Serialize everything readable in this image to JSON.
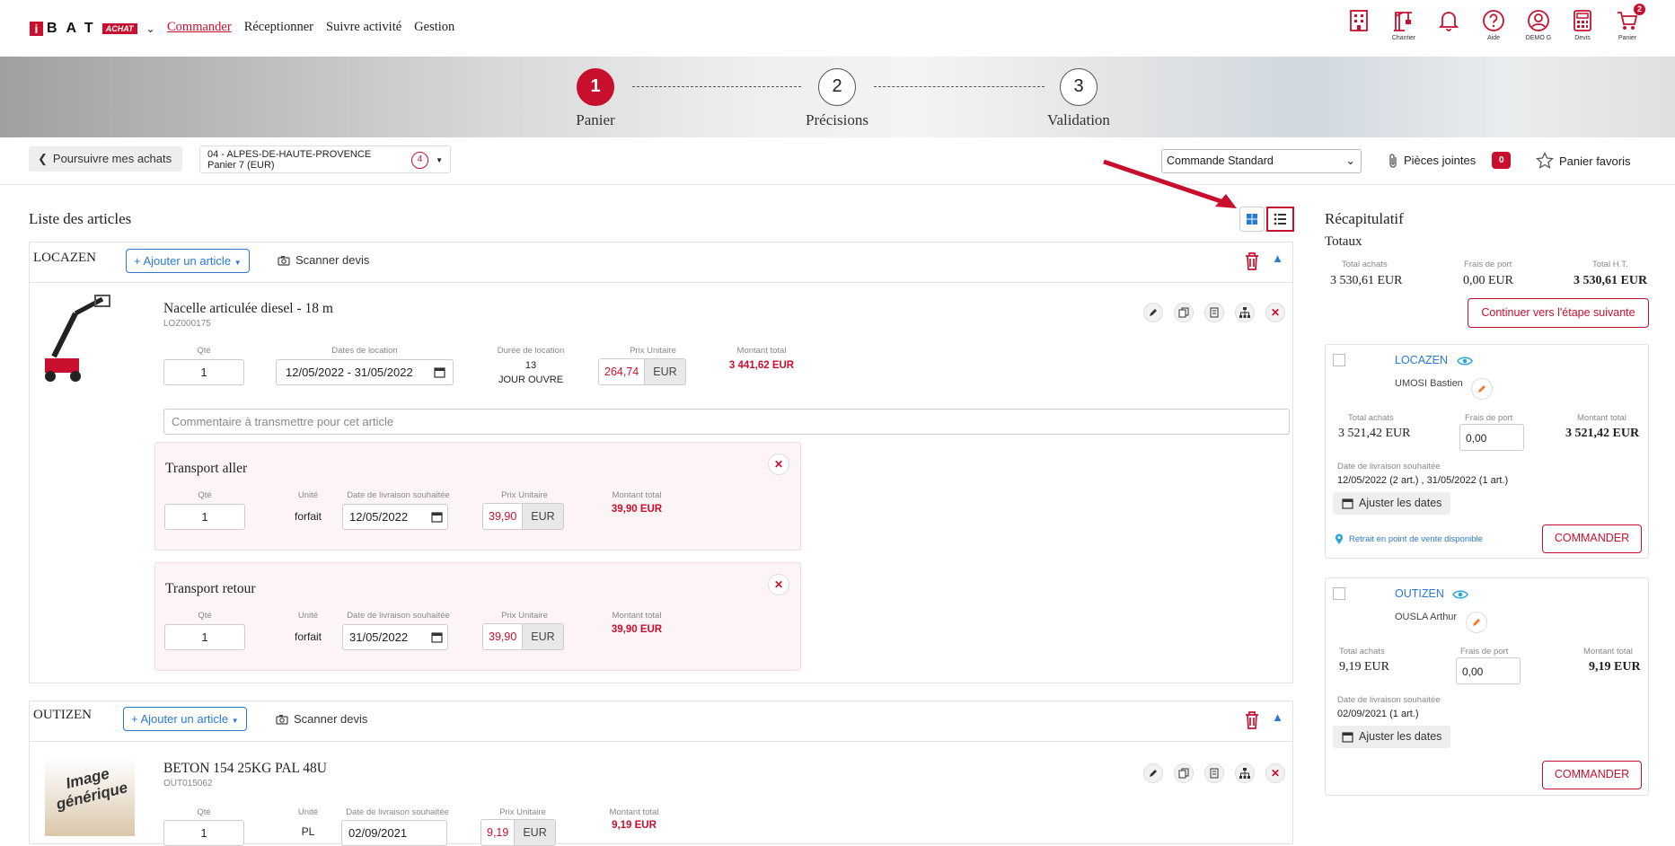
{
  "brand": {
    "name": "BAT",
    "badge": "ACHAT"
  },
  "nav": [
    "Commander",
    "Réceptionner",
    "Suivre activité",
    "Gestion"
  ],
  "top_icons": [
    {
      "icon": "building-icon",
      "label": ""
    },
    {
      "icon": "crane-icon",
      "label": "Chantier"
    },
    {
      "icon": "bell-icon",
      "label": ""
    },
    {
      "icon": "help-icon",
      "label": "Aide"
    },
    {
      "icon": "user-icon",
      "label": "DEMO G"
    },
    {
      "icon": "calculator-icon",
      "label": "Devis"
    },
    {
      "icon": "cart-icon",
      "label": "Panier",
      "badge": "2"
    }
  ],
  "steps": [
    {
      "num": "1",
      "label": "Panier"
    },
    {
      "num": "2",
      "label": "Précisions"
    },
    {
      "num": "3",
      "label": "Validation"
    }
  ],
  "toolbar": {
    "continue": "Poursuivre mes achats",
    "cart_line1": "04 - ALPES-DE-HAUTE-PROVENCE",
    "cart_line2": "Panier 7 (EUR)",
    "cart_count": "4",
    "order_type": "Commande Standard",
    "attachments": "Pièces jointes",
    "attachments_count": "0",
    "favorites": "Panier favoris"
  },
  "list_title": "Liste des articles",
  "suppliers": [
    {
      "name": "LOCAZEN",
      "add": "Ajouter un article",
      "scan": "Scanner devis",
      "article": {
        "title": "Nacelle articulée diesel - 18 m",
        "ref": "LOZ000175",
        "qty_label": "Qté",
        "qty": "1",
        "dates_label": "Dates de location",
        "dates": "12/05/2022 - 31/05/2022",
        "duration_label": "Durée de location",
        "duration": "13",
        "duration_unit": "JOUR OUVRE",
        "unit_price_label": "Prix Unitaire",
        "unit_price": "264,74",
        "currency": "EUR",
        "total_label": "Montant total",
        "total": "3 441,62 EUR",
        "comment_placeholder": "Commentaire à transmettre pour cet article"
      },
      "transports": [
        {
          "title": "Transport aller",
          "qty_label": "Qté",
          "qty": "1",
          "unit_label": "Unité",
          "unit": "forfait",
          "date_label": "Date de livraison souhaitée",
          "date": "12/05/2022",
          "price_label": "Prix Unitaire",
          "price": "39,90",
          "currency": "EUR",
          "total_label": "Montant total",
          "total": "39,90 EUR"
        },
        {
          "title": "Transport retour",
          "qty_label": "Qté",
          "qty": "1",
          "unit_label": "Unité",
          "unit": "forfait",
          "date_label": "Date de livraison souhaitée",
          "date": "31/05/2022",
          "price_label": "Prix Unitaire",
          "price": "39,90",
          "currency": "EUR",
          "total_label": "Montant total",
          "total": "39,90 EUR"
        }
      ]
    },
    {
      "name": "OUTIZEN",
      "add": "Ajouter un article",
      "scan": "Scanner devis",
      "article": {
        "title": "BETON 154 25KG PAL 48U",
        "ref": "OUT015062",
        "image_text": "Image générique",
        "qty_label": "Qté",
        "qty": "1",
        "unit_label": "Unité",
        "unit": "PL",
        "date_label": "Date de livraison souhaitée",
        "date": "02/09/2021",
        "price_label": "Prix Unitaire",
        "price": "9,19",
        "currency": "EUR",
        "total_label": "Montant total",
        "total": "9,19 EUR"
      }
    }
  ],
  "recap": {
    "title": "Récapitulatif",
    "totals_title": "Totaux",
    "labels": [
      "Total achats",
      "Frais de port",
      "Total H.T."
    ],
    "values": [
      "3 530,61 EUR",
      "0,00 EUR",
      "3 530,61 EUR"
    ],
    "next_step": "Continuer vers l'étape suivante",
    "cards": [
      {
        "name": "LOCAZEN",
        "person": "UMOSI Bastien",
        "labels": [
          "Total achats",
          "Frais de port",
          "Montant total"
        ],
        "total_purchases": "3 521,42 EUR",
        "shipping": "0,00",
        "total": "3 521,42 EUR",
        "date_label": "Date de livraison souhaitée",
        "dates": "12/05/2022 (2 art.) , 31/05/2022 (1 art.)",
        "adjust": "Ajuster les dates",
        "retrait": "Retrait en point de vente disponible",
        "order": "COMMANDER"
      },
      {
        "name": "OUTIZEN",
        "person": "OUSLA Arthur",
        "labels": [
          "Total achats",
          "Frais de port",
          "Montant total"
        ],
        "total_purchases": "9,19 EUR",
        "shipping": "0,00",
        "total": "9,19 EUR",
        "date_label": "Date de livraison souhaitée",
        "dates": "02/09/2021 (1 art.)",
        "adjust": "Ajuster les dates",
        "order": "COMMANDER"
      }
    ]
  },
  "colors": {
    "accent": "#c8102e",
    "link": "#2a7ad2"
  }
}
